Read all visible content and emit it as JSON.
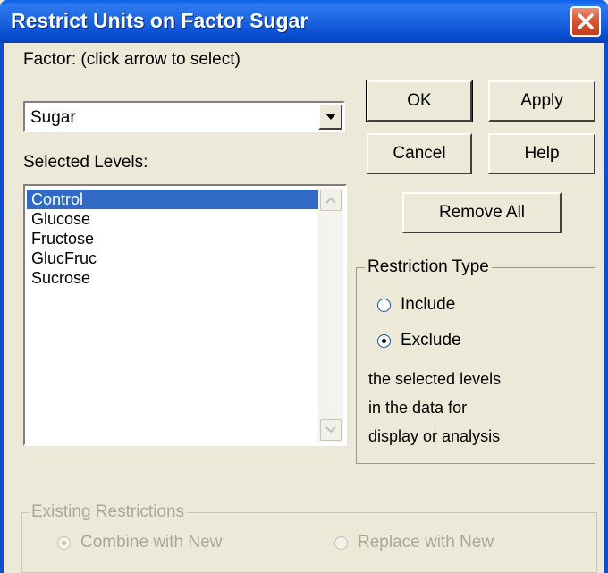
{
  "window": {
    "title": "Restrict Units on Factor Sugar"
  },
  "factor": {
    "label": "Factor: (click arrow to select)",
    "selected": "Sugar"
  },
  "levels": {
    "label": "Selected Levels:",
    "items": [
      "Control",
      "Glucose",
      "Fructose",
      "GlucFruc",
      "Sucrose"
    ],
    "selected_index": 0
  },
  "buttons": {
    "ok": "OK",
    "apply": "Apply",
    "cancel": "Cancel",
    "help": "Help",
    "remove_all": "Remove All"
  },
  "restriction_type": {
    "title": "Restriction Type",
    "options": [
      "Include",
      "Exclude"
    ],
    "selected": "Exclude",
    "description": [
      "the selected levels",
      "in the data for",
      "display or analysis"
    ]
  },
  "existing_restrictions": {
    "title": "Existing Restrictions",
    "options": [
      "Combine with New",
      "Replace with New"
    ],
    "selected": "Combine with New",
    "enabled": false
  },
  "colors": {
    "titlebar": "#0a4fd4",
    "selection": "#316ac5",
    "dialog_bg": "#ece9d8"
  }
}
